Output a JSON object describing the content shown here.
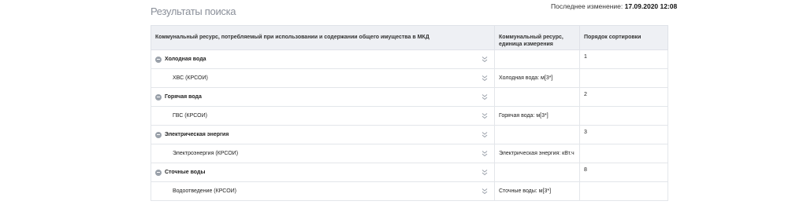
{
  "page": {
    "title": "Результаты поиска",
    "last_modified_label": "Последнее изменение:",
    "last_modified_value": "17.09.2020 12:08"
  },
  "table": {
    "headers": {
      "resource": "Коммунальный ресурс, потребляемый при использовании и содержании общего имущества в МКД",
      "unit_line1": "Коммунальный ресурс,",
      "unit_line2": "единица измерения",
      "sort": "Порядок сортировки"
    },
    "rows": [
      {
        "type": "group",
        "name": "Холодная вода",
        "unit": "",
        "sort": "1"
      },
      {
        "type": "child",
        "name": "ХВС (КРСОИ)",
        "unit": "Холодная вода: м[3*]",
        "sort": ""
      },
      {
        "type": "group",
        "name": "Горячая вода",
        "unit": "",
        "sort": "2"
      },
      {
        "type": "child",
        "name": "ГВС (КРСОИ)",
        "unit": "Горячая вода: м[3*]",
        "sort": ""
      },
      {
        "type": "group",
        "name": "Электрическая энергия",
        "unit": "",
        "sort": "3"
      },
      {
        "type": "child",
        "name": "Электроэнергия (КРСОИ)",
        "unit": "Электрическая энергия: кВт.ч",
        "sort": ""
      },
      {
        "type": "group",
        "name": "Сточные воды",
        "unit": "",
        "sort": "8"
      },
      {
        "type": "child",
        "name": "Водоотведение (КРСОИ)",
        "unit": "Сточные воды: м[3*]",
        "sort": ""
      }
    ]
  },
  "icons": {
    "toggle": "collapse-circle-icon",
    "expand": "double-chevron-down-icon",
    "accent": "#9aa1aa"
  }
}
